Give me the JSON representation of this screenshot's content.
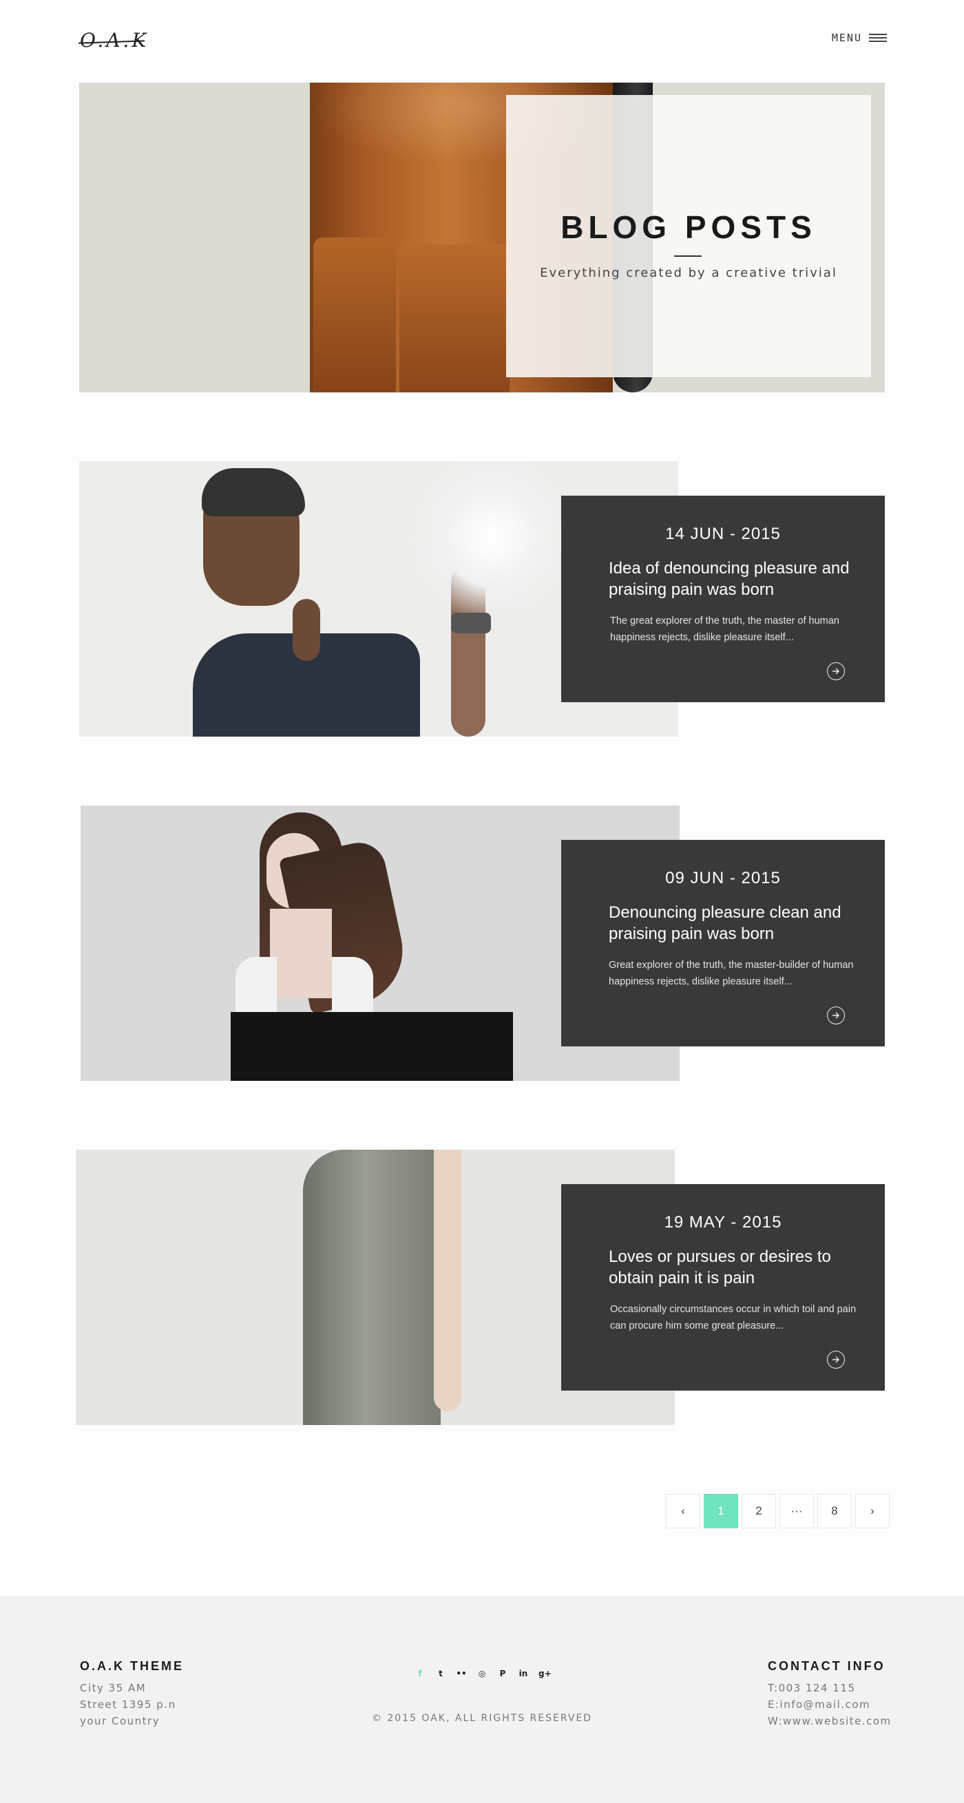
{
  "header": {
    "logo": "O.A.K",
    "menu_label": "MENU"
  },
  "hero": {
    "title": "BLOG POSTS",
    "subtitle": "Everything created by a creative trivial"
  },
  "posts": [
    {
      "date": "14 JUN - 2015",
      "title": "Idea of denouncing pleasure and praising pain was born",
      "excerpt": "The great explorer of the truth, the master of human happiness rejects, dislike pleasure itself..."
    },
    {
      "date": "09 JUN - 2015",
      "title": "Denouncing pleasure clean and praising pain was born",
      "excerpt": "Great explorer of the truth, the master-builder of human happiness rejects, dislike pleasure itself..."
    },
    {
      "date": "19 MAY - 2015",
      "title": "Loves or pursues or desires to obtain pain it is pain",
      "excerpt": "Occasionally circumstances occur in which toil and pain can procure him some great pleasure..."
    }
  ],
  "pagination": {
    "prev": "‹",
    "pages": [
      "1",
      "2",
      "···",
      "8"
    ],
    "next": "›",
    "active_color": "#6fe3bf"
  },
  "footer": {
    "theme_title": "O.A.K THEME",
    "address": [
      "City 35 AM",
      "Street 1395 p.n",
      "your Country"
    ],
    "social_icons": [
      "facebook-icon",
      "twitter-icon",
      "flickr-icon",
      "dribbble-icon",
      "pinterest-icon",
      "linkedin-icon",
      "google-plus-icon"
    ],
    "social_glyphs": [
      "f",
      "t",
      "••",
      "◎",
      "P",
      "in",
      "g+"
    ],
    "copyright": "© 2015 OAK, ALL RIGHTS RESERVED",
    "contact_title": "CONTACT INFO",
    "contact": [
      "T:003 124 115",
      "E:info@mail.com",
      "W:www.website.com"
    ]
  }
}
